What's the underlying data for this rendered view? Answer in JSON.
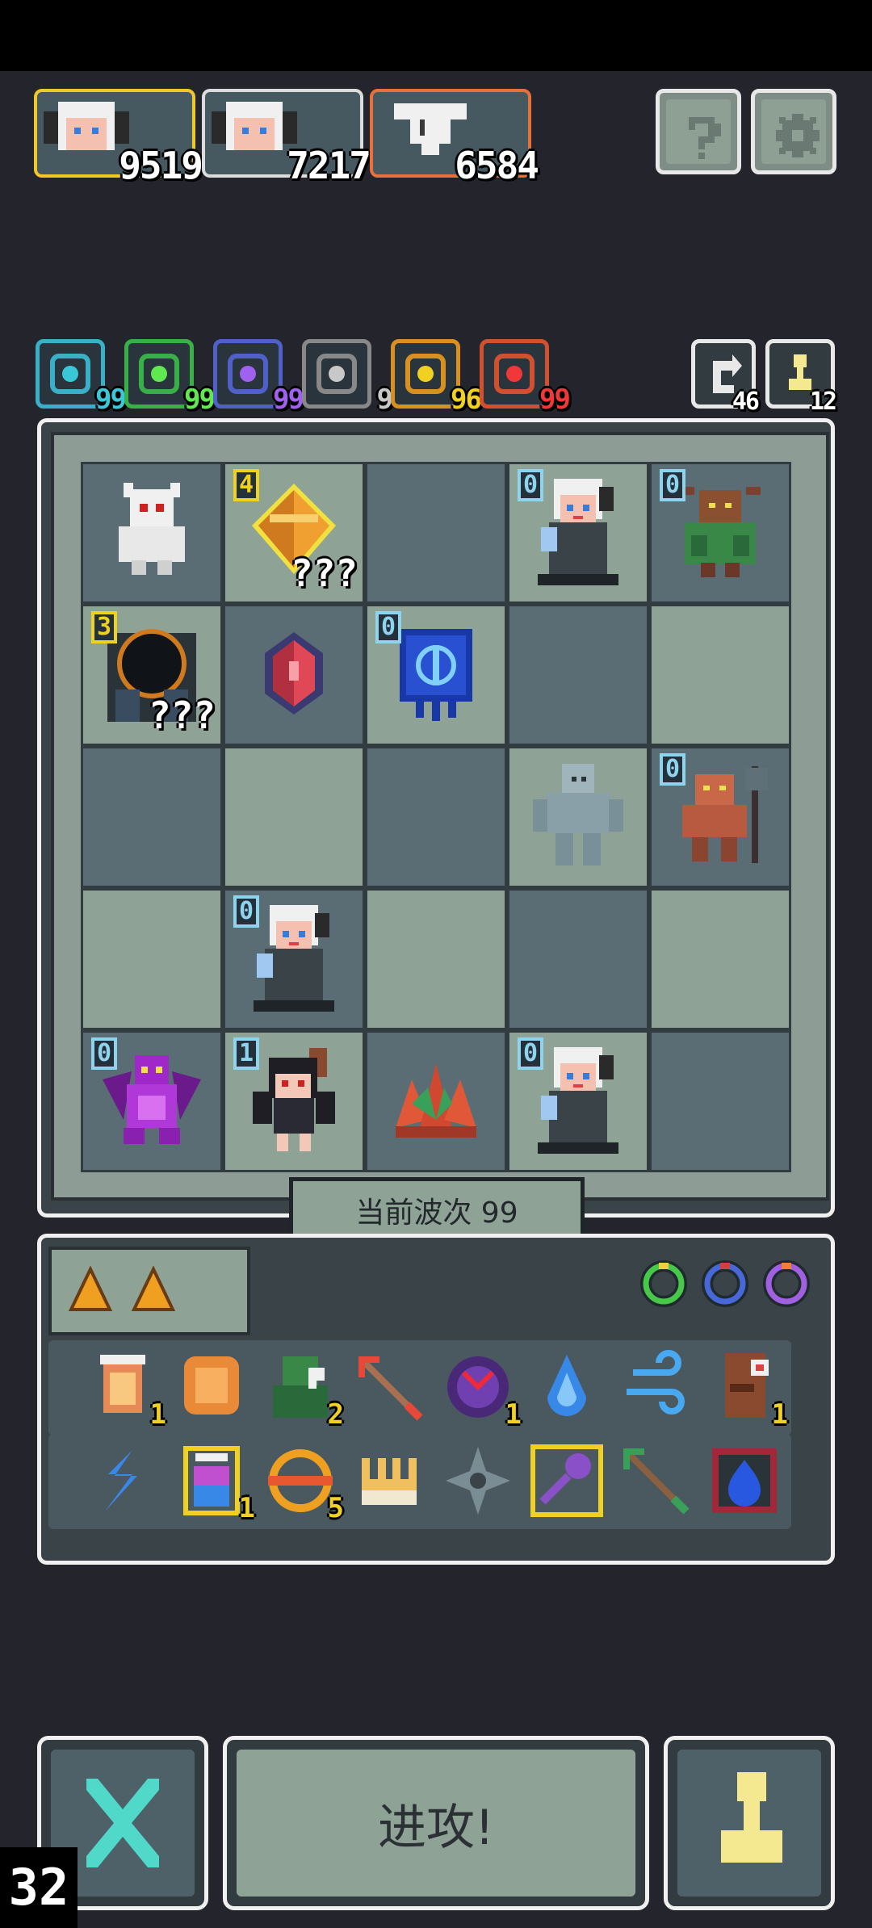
{
  "top_heroes": [
    {
      "value": "9519",
      "border": "gold"
    },
    {
      "value": "7217",
      "border": "white"
    },
    {
      "value": "6584",
      "border": "orange"
    }
  ],
  "header_buttons": {
    "help": "?",
    "settings": "gear-icon"
  },
  "stats": [
    {
      "icon": "at-icon",
      "value": "99",
      "color": "#3ab0c8",
      "text_color": "#3ac8d8"
    },
    {
      "icon": "gem-icon",
      "value": "99",
      "color": "#38b048",
      "text_color": "#60e850"
    },
    {
      "icon": "lightning-icon",
      "value": "99",
      "color": "#5060c8",
      "text_color": "#a060f0"
    },
    {
      "icon": "wing-icon",
      "value": "9",
      "color": "#888",
      "text_color": "#c8c8c8"
    },
    {
      "icon": "arrow-up-icon",
      "value": "96",
      "color": "#d89020",
      "text_color": "#f0d020"
    },
    {
      "icon": "fire-arrow-icon",
      "value": "99",
      "color": "#d05030",
      "text_color": "#f03838"
    }
  ],
  "side_counters": [
    {
      "icon": "refresh-icon",
      "value": "46"
    },
    {
      "icon": "pawn-icon",
      "value": "12"
    }
  ],
  "board": [
    [
      {
        "s": "white-ghost",
        "lv": ""
      },
      {
        "s": "orange-crystal",
        "lv": "4",
        "q": "???",
        "tc": "yel"
      },
      {
        "s": "",
        "lv": ""
      },
      {
        "s": "white-hair-girl",
        "lv": "0"
      },
      {
        "s": "minotaur",
        "lv": "0"
      }
    ],
    [
      {
        "s": "dark-portal",
        "lv": "3",
        "q": "???",
        "tc": "yel"
      },
      {
        "s": "red-gem",
        "lv": ""
      },
      {
        "s": "blue-rune",
        "lv": "0"
      },
      {
        "s": "",
        "lv": ""
      },
      {
        "s": "",
        "lv": ""
      }
    ],
    [
      {
        "s": "",
        "lv": ""
      },
      {
        "s": "",
        "lv": ""
      },
      {
        "s": "",
        "lv": ""
      },
      {
        "s": "stone-golem",
        "lv": ""
      },
      {
        "s": "orc-axe",
        "lv": "0"
      }
    ],
    [
      {
        "s": "",
        "lv": ""
      },
      {
        "s": "white-hair-girl",
        "lv": "0"
      },
      {
        "s": "",
        "lv": ""
      },
      {
        "s": "",
        "lv": ""
      },
      {
        "s": "",
        "lv": ""
      }
    ],
    [
      {
        "s": "purple-dragon",
        "lv": "0"
      },
      {
        "s": "horned-girl",
        "lv": "1"
      },
      {
        "s": "red-plant",
        "lv": ""
      },
      {
        "s": "white-hair-girl",
        "lv": "0"
      },
      {
        "s": "",
        "lv": ""
      }
    ]
  ],
  "wave_label": "当前波次 99",
  "inventory_top": [
    "orange-triangle-icon",
    "orange-triangle-icon"
  ],
  "rings": [
    "green-ring-icon",
    "blue-ring-icon",
    "purple-ring-icon"
  ],
  "inventory_row1": [
    {
      "icon": "lantern-icon",
      "count": "1"
    },
    {
      "icon": "armor-icon",
      "count": ""
    },
    {
      "icon": "goblin-icon",
      "count": "2"
    },
    {
      "icon": "arrow-icon",
      "count": ""
    },
    {
      "icon": "demon-orb-icon",
      "count": "1"
    },
    {
      "icon": "water-drop-icon",
      "count": ""
    },
    {
      "icon": "wind-icon",
      "count": ""
    },
    {
      "icon": "totem-icon",
      "count": "1"
    }
  ],
  "inventory_row2": [
    {
      "icon": "blue-swirl-icon",
      "count": ""
    },
    {
      "icon": "potion-icon",
      "count": "1"
    },
    {
      "icon": "compass-icon",
      "count": "5"
    },
    {
      "icon": "claw-icon",
      "count": ""
    },
    {
      "icon": "shuriken-icon",
      "count": ""
    },
    {
      "icon": "key-icon",
      "count": ""
    },
    {
      "icon": "green-arrow-icon",
      "count": ""
    },
    {
      "icon": "blue-flame-icon",
      "count": ""
    }
  ],
  "attack_label": "进攻!",
  "counter": "32"
}
